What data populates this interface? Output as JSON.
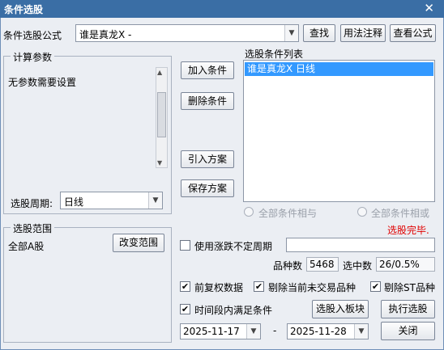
{
  "title": "条件选股",
  "close_glyph": "✕",
  "formula": {
    "label": "条件选股公式",
    "value": "谁是真龙X  -"
  },
  "buttons": {
    "find": "查找",
    "usage": "用法注释",
    "view": "查看公式",
    "add": "加入条件",
    "delete": "删除条件",
    "import": "引入方案",
    "save": "保存方案",
    "change_range": "改变范围",
    "to_block": "选股入板块",
    "execute": "执行选股",
    "close": "关闭"
  },
  "calc_params": {
    "title": "计算参数",
    "text": "无参数需要设置"
  },
  "period": {
    "label": "选股周期:",
    "value": "日线"
  },
  "cond_list": {
    "title": "选股条件列表",
    "items": [
      "谁是真龙X  日线"
    ]
  },
  "relation": {
    "and": "全部条件相与",
    "or": "全部条件相或"
  },
  "status": "选股完毕.",
  "status_color": "#e00000",
  "range": {
    "title": "选股范围",
    "value": "全部A股"
  },
  "use_period": {
    "label": "使用涨跌不定周期",
    "checked": false
  },
  "counts": {
    "total_label": "品种数",
    "total": "5468",
    "selected_label": "选中数",
    "selected": "26/0.5%"
  },
  "options": [
    {
      "label": "前复权数据",
      "checked": true
    },
    {
      "label": "剔除当前未交易品种",
      "checked": true
    },
    {
      "label": "剔除ST品种",
      "checked": true
    }
  ],
  "time_cond": {
    "label": "时间段内满足条件",
    "checked": true
  },
  "dates": {
    "start": "2025-11-17",
    "sep": "-",
    "end": "2025-11-28"
  },
  "check_glyph": "✔",
  "arrow_glyph": "▼",
  "scroll_up": "▲",
  "scroll_down": "▼"
}
